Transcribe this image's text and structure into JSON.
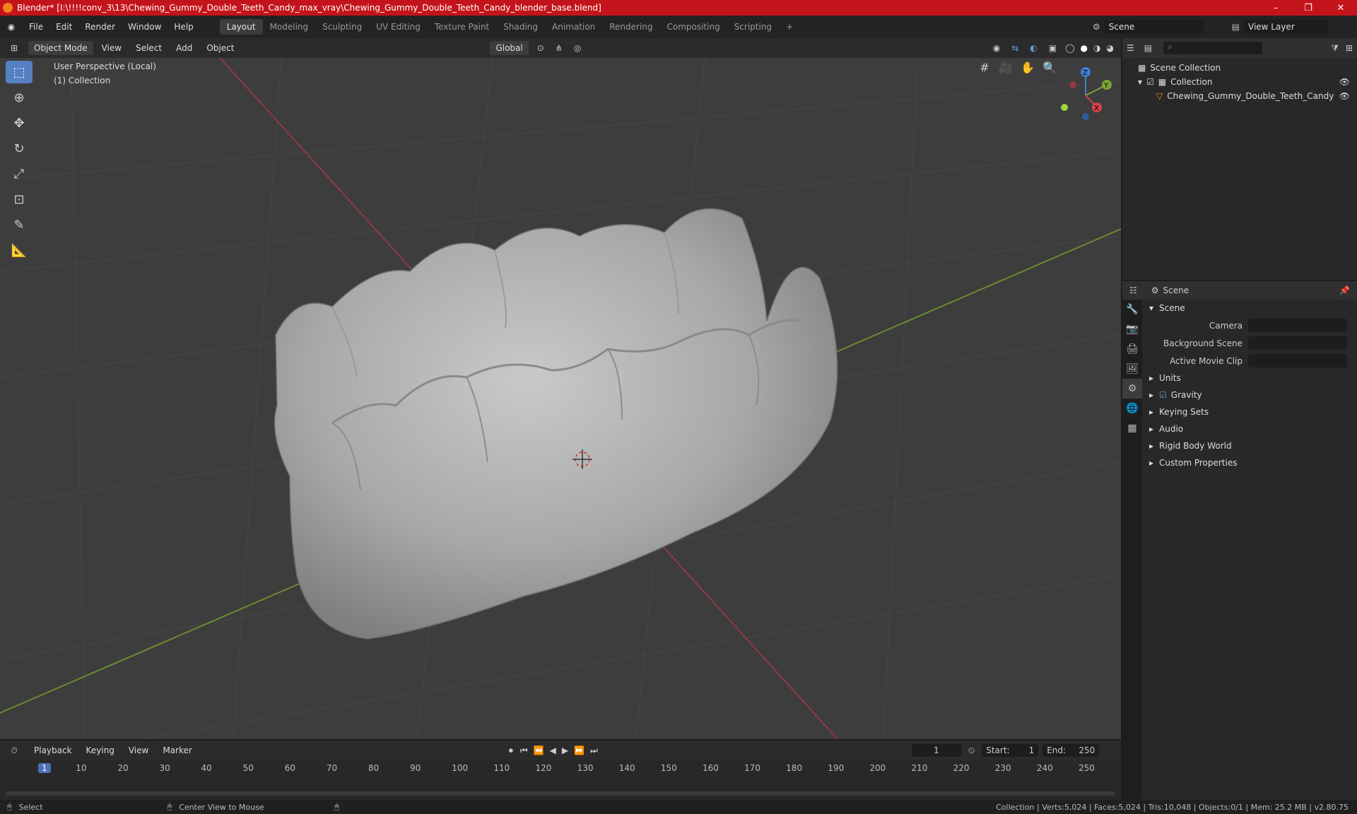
{
  "window": {
    "title": "Blender* [I:\\!!!!conv_3\\13\\Chewing_Gummy_Double_Teeth_Candy_max_vray\\Chewing_Gummy_Double_Teeth_Candy_blender_base.blend]",
    "minimize": "–",
    "maximize": "❐",
    "close": "✕"
  },
  "menu": {
    "items": [
      "File",
      "Edit",
      "Render",
      "Window",
      "Help"
    ]
  },
  "workspaces": [
    "Layout",
    "Modeling",
    "Sculpting",
    "UV Editing",
    "Texture Paint",
    "Shading",
    "Animation",
    "Rendering",
    "Compositing",
    "Scripting"
  ],
  "add_workspace": "+",
  "scene_selector": {
    "label": "Scene"
  },
  "viewlayer_selector": {
    "label": "View Layer"
  },
  "viewport_header": {
    "mode": "Object Mode",
    "menus": [
      "View",
      "Select",
      "Add",
      "Object"
    ],
    "orientation": "Global"
  },
  "viewport": {
    "perspective": "User Perspective (Local)",
    "collection": "(1) Collection"
  },
  "gizmo": {
    "x": "X",
    "y": "Y",
    "z": "Z"
  },
  "outliner": {
    "root": "Scene Collection",
    "collection": "Collection",
    "object": "Chewing_Gummy_Double_Teeth_Candy"
  },
  "properties": {
    "header": "Scene",
    "section": "Scene",
    "fields": [
      {
        "label": "Camera"
      },
      {
        "label": "Background Scene"
      },
      {
        "label": "Active Movie Clip"
      }
    ],
    "panels": [
      "Units",
      "Gravity",
      "Keying Sets",
      "Audio",
      "Rigid Body World",
      "Custom Properties"
    ]
  },
  "timeline": {
    "menus": [
      "Playback",
      "Keying",
      "View",
      "Marker"
    ],
    "current_frame": "1",
    "start_label": "Start:",
    "start": "1",
    "end_label": "End:",
    "end": "250",
    "ticks": [
      "1",
      "10",
      "20",
      "30",
      "40",
      "50",
      "60",
      "70",
      "80",
      "90",
      "100",
      "110",
      "120",
      "130",
      "140",
      "150",
      "160",
      "170",
      "180",
      "190",
      "200",
      "210",
      "220",
      "230",
      "240",
      "250"
    ]
  },
  "status": {
    "select": "Select",
    "center": "Center View to Mouse",
    "stats": "Collection | Verts:5,024 | Faces:5,024 | Tris:10,048 | Objects:0/1 | Mem: 25.2 MB | v2.80.75"
  }
}
